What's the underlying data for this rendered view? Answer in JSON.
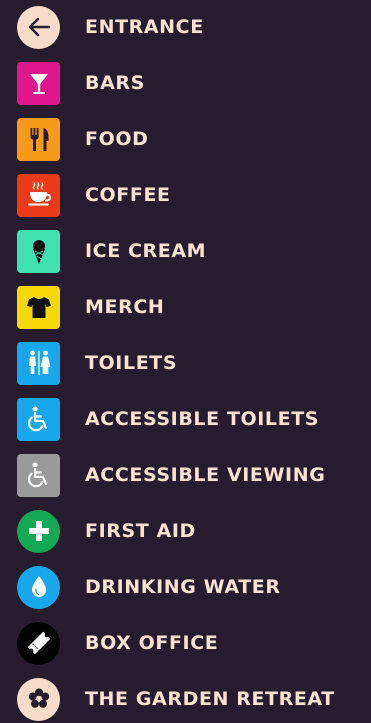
{
  "items": [
    {
      "label": "ENTRANCE",
      "icon": "arrow-left-icon",
      "color": "#f6dcc9"
    },
    {
      "label": "BARS",
      "icon": "cocktail-glass-icon",
      "color": "#e0178c"
    },
    {
      "label": "FOOD",
      "icon": "fork-knife-icon",
      "color": "#f59a1a"
    },
    {
      "label": "COFFEE",
      "icon": "coffee-cup-icon",
      "color": "#ea3a18"
    },
    {
      "label": "ICE CREAM",
      "icon": "ice-cream-cone-icon",
      "color": "#40e0b0"
    },
    {
      "label": "MERCH",
      "icon": "t-shirt-icon",
      "color": "#f7d90a"
    },
    {
      "label": "TOILETS",
      "icon": "toilets-icon",
      "color": "#17a7ea"
    },
    {
      "label": "ACCESSIBLE TOILETS",
      "icon": "wheelchair-icon",
      "color": "#17a7ea"
    },
    {
      "label": "ACCESSIBLE VIEWING",
      "icon": "wheelchair-icon",
      "color": "#9a9a9a"
    },
    {
      "label": "FIRST AID",
      "icon": "first-aid-cross-icon",
      "color": "#13a853"
    },
    {
      "label": "DRINKING WATER",
      "icon": "water-drop-icon",
      "color": "#17a7ea"
    },
    {
      "label": "BOX OFFICE",
      "icon": "ticket-icon",
      "color": "#000000"
    },
    {
      "label": "THE GARDEN RETREAT",
      "icon": "flower-icon",
      "color": "#f6dcc9"
    }
  ]
}
